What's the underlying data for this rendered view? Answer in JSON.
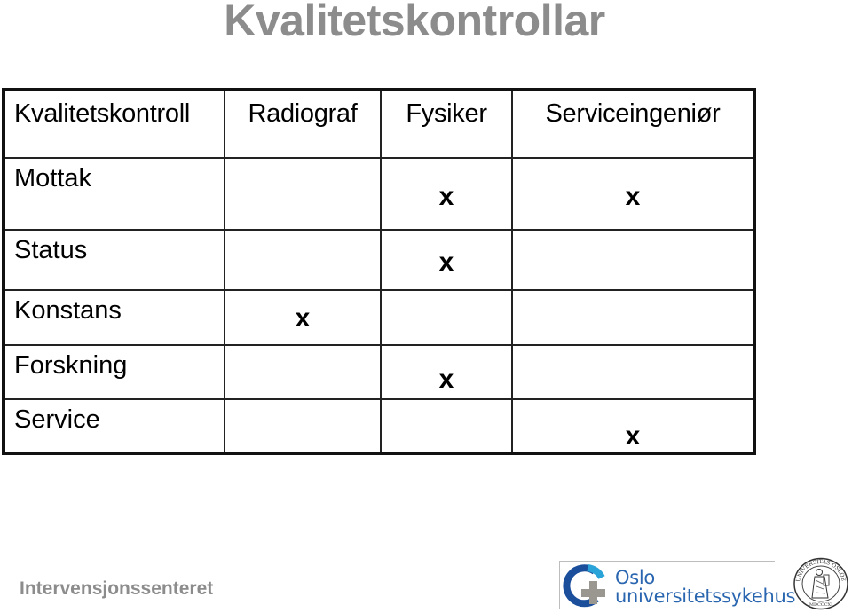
{
  "slide": {
    "title": "Kvalitetskontrollar"
  },
  "table": {
    "headers": [
      "Kvalitetskontroll",
      "Radiograf",
      "Fysiker",
      "Serviceingeniør"
    ],
    "rows": [
      {
        "label": "Mottak",
        "cells": [
          "",
          "x",
          "x"
        ]
      },
      {
        "label": "Status",
        "cells": [
          "",
          "x",
          ""
        ]
      },
      {
        "label": "Konstans",
        "cells": [
          "x",
          "",
          ""
        ]
      },
      {
        "label": "Forskning",
        "cells": [
          "",
          "x",
          ""
        ]
      },
      {
        "label": "Service",
        "cells": [
          "",
          "",
          "x"
        ]
      }
    ]
  },
  "footer": {
    "department": "Intervensjonssenteret",
    "hospital_logo": {
      "line1": "Oslo",
      "line2": "universitetssykehus",
      "icon": "ous-cross-logo-icon",
      "colors": {
        "arc": "#1b4f9c",
        "arc_accent": "#2aa3d8",
        "cross": "#9a9690",
        "text": "#2a66b0"
      }
    },
    "university_seal": {
      "icon": "uio-seal-icon",
      "text": "UNIVERSITAS OSLOENSIS MDCCCXI"
    }
  }
}
